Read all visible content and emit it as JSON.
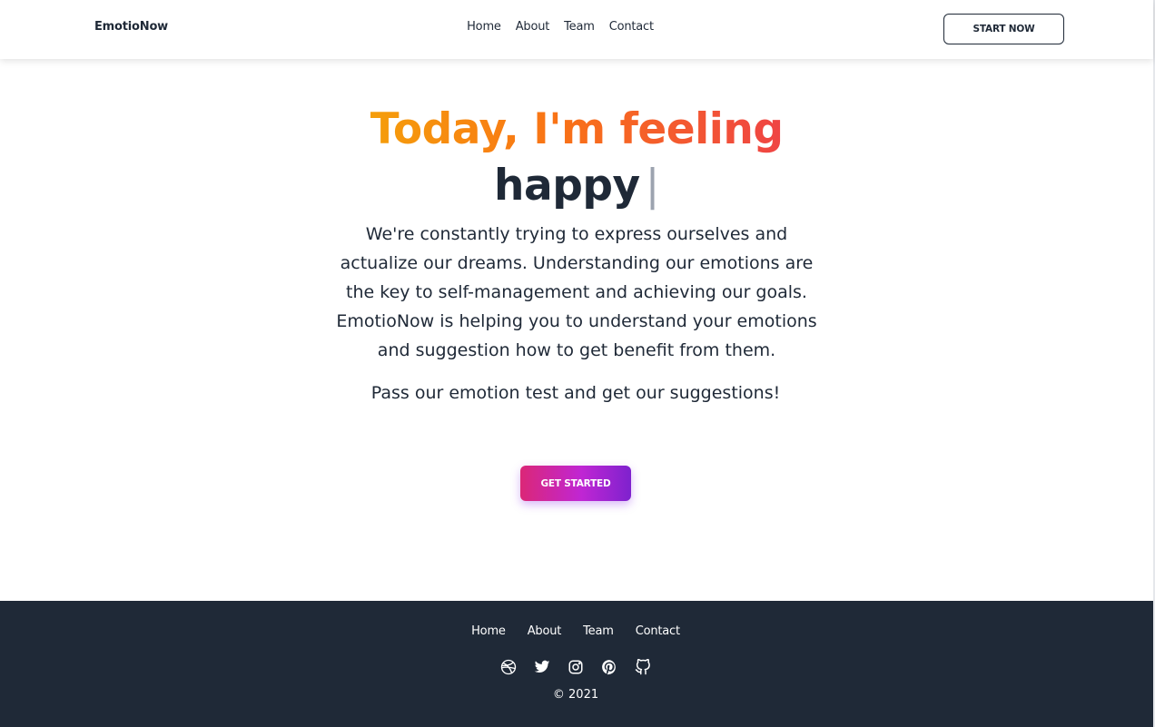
{
  "header": {
    "brand": "EmotioNow",
    "nav": [
      "Home",
      "About",
      "Team",
      "Contact"
    ],
    "cta": "START NOW"
  },
  "hero": {
    "title_line1": "Today, I'm feeling",
    "emotion_word": "happy",
    "cursor": "|",
    "description": "We're constantly trying to express ourselves and actualize our dreams. Understanding our emotions are the key to self-management and achieving our goals. EmotioNow is helping you to understand your emotions and suggestion how to get benefit from them.",
    "cta_text": "Pass our emotion test and get our suggestions!",
    "button": "GET STARTED"
  },
  "footer": {
    "nav": [
      "Home",
      "About",
      "Team",
      "Contact"
    ],
    "socials": [
      "dribbble-icon",
      "twitter-icon",
      "instagram-icon",
      "pinterest-icon",
      "github-icon"
    ],
    "copyright": "© 2021"
  },
  "colors": {
    "title_gradient_start": "#f59e0b",
    "title_gradient_end": "#ef4444",
    "button_gradient_start": "#db2777",
    "button_gradient_end": "#7e22ce",
    "footer_bg": "#1f2937",
    "text": "#1f2937"
  }
}
